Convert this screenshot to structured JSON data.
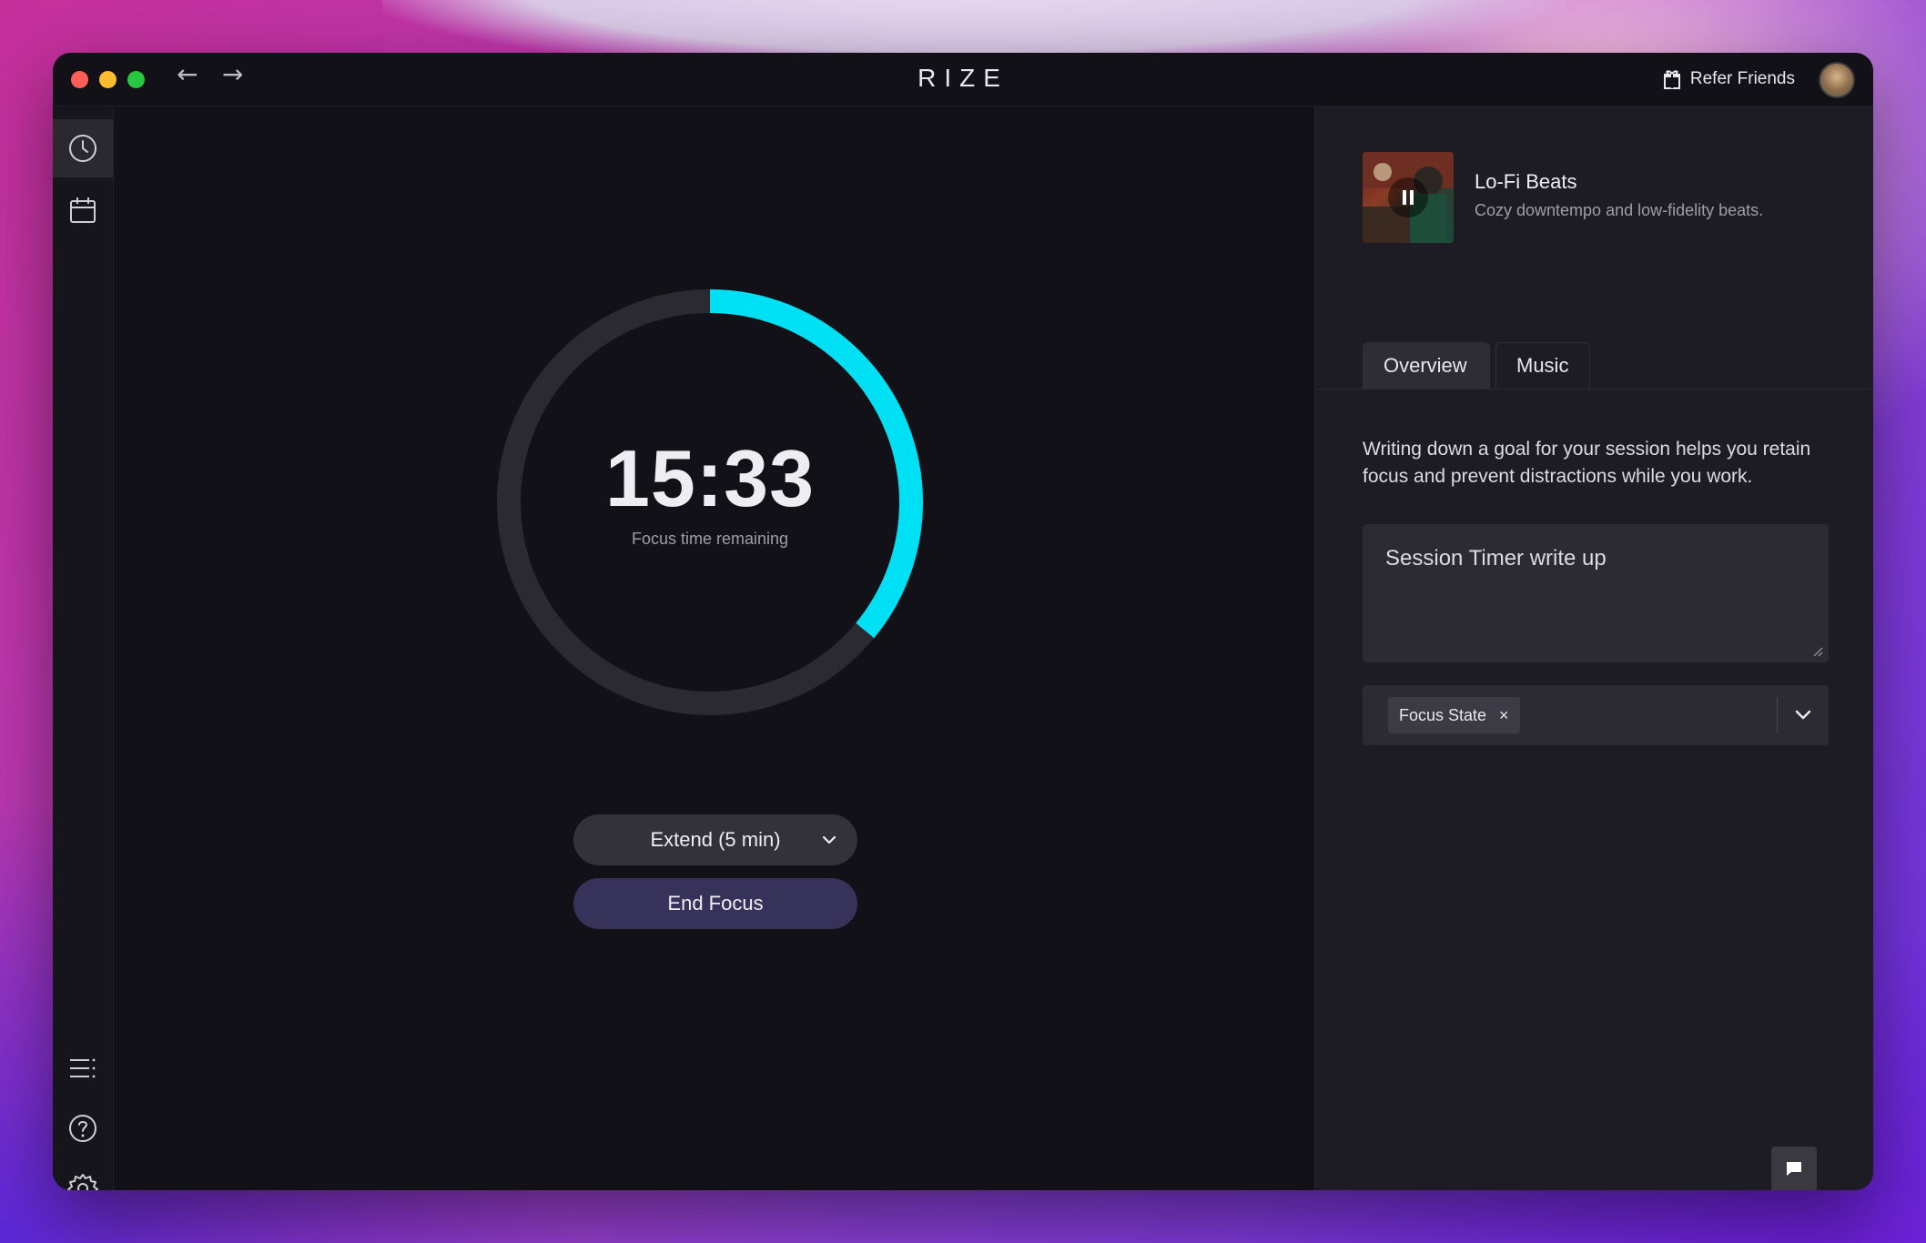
{
  "window": {
    "app_title": "RIZE",
    "refer_label": "Refer Friends"
  },
  "nav": {
    "back_glyph": "←",
    "forward_glyph": "→"
  },
  "sidebar": {
    "top_items": [
      {
        "icon": "clock-icon",
        "active": true
      },
      {
        "icon": "calendar-icon",
        "active": false
      }
    ],
    "bottom_items": [
      {
        "icon": "list-icon"
      },
      {
        "icon": "help-icon"
      },
      {
        "icon": "gear-icon"
      }
    ]
  },
  "timer": {
    "time": "15:33",
    "label": "Focus time remaining",
    "progress_fraction": 0.36,
    "track_color": "#2b2a32",
    "progress_color": "#00e0f5"
  },
  "actions": {
    "extend_label": "Extend (5 min)",
    "end_label": "End Focus"
  },
  "music": {
    "track_title": "Lo-Fi Beats",
    "track_subtitle": "Cozy downtempo and low-fidelity beats."
  },
  "tabs": [
    {
      "label": "Overview",
      "active": true
    },
    {
      "label": "Music",
      "active": false
    }
  ],
  "overview": {
    "hint": "Writing down a goal for your session helps you retain focus and prevent distractions while you work.",
    "goal_value": "Session Timer write up",
    "tag": "Focus State",
    "tag_remove_glyph": "×"
  }
}
